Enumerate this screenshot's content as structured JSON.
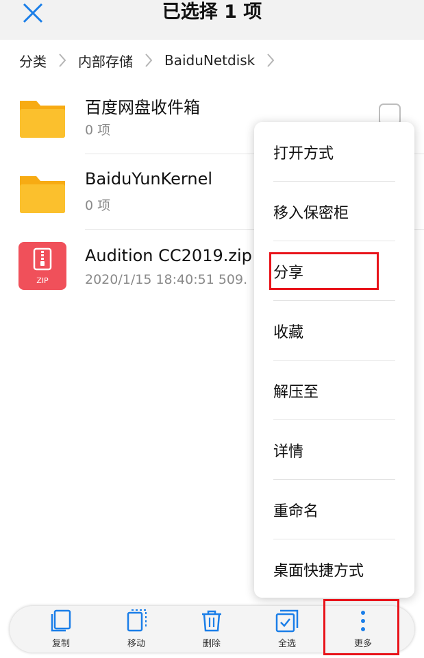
{
  "header": {
    "title": "已选择 1 项"
  },
  "breadcrumb": {
    "items": [
      "分类",
      "内部存储",
      "BaiduNetdisk"
    ]
  },
  "files": [
    {
      "name": "百度网盘收件箱",
      "meta": "0 项",
      "icon": "folder-icon"
    },
    {
      "name": "BaiduYunKernel",
      "meta": "0 项",
      "icon": "folder-icon"
    },
    {
      "name": "Audition CC2019.zip",
      "meta": "2020/1/15 18:40:51 509.",
      "icon": "zip-file-icon",
      "badge": "ZIP"
    }
  ],
  "menu": {
    "items": [
      "打开方式",
      "移入保密柜",
      "分享",
      "收藏",
      "解压至",
      "详情",
      "重命名",
      "桌面快捷方式"
    ]
  },
  "toolbar": {
    "items": [
      {
        "label": "复制",
        "icon": "copy-icon"
      },
      {
        "label": "移动",
        "icon": "move-icon"
      },
      {
        "label": "删除",
        "icon": "trash-icon"
      },
      {
        "label": "全选",
        "icon": "select-all-icon"
      },
      {
        "label": "更多",
        "icon": "more-icon"
      }
    ]
  },
  "colors": {
    "accent": "#1a7ee8",
    "folder": "#fbbf1c",
    "zip": "#f0505a",
    "highlight": "#e8131a"
  }
}
